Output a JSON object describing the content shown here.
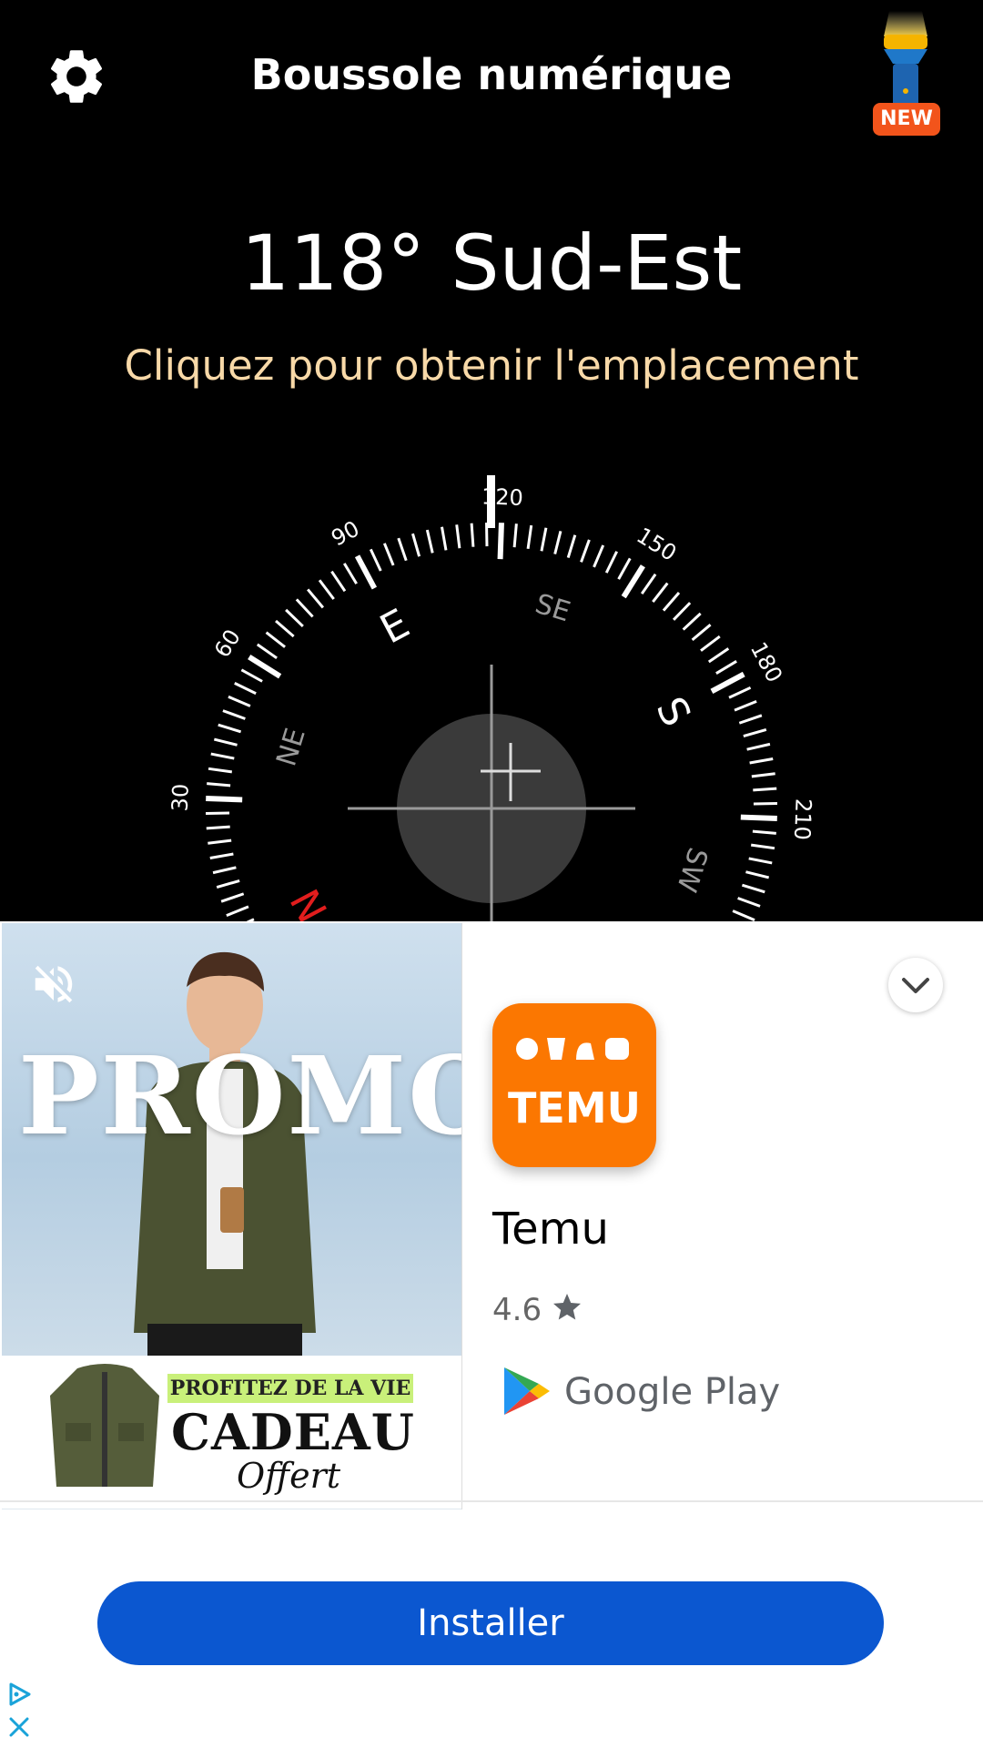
{
  "header": {
    "title": "Boussole numérique",
    "settings_icon": "gear-icon",
    "flashlight_icon": "flashlight-icon",
    "new_badge": "NEW"
  },
  "heading": {
    "degrees": "118°",
    "direction": "Sud-Est"
  },
  "location_prompt": "Cliquez pour obtenir l'emplacement",
  "compass": {
    "heading_value": 118,
    "tick_labels": [
      "30",
      "60",
      "90",
      "120",
      "150",
      "180",
      "210"
    ],
    "cardinals": [
      "N",
      "E",
      "S"
    ],
    "intercardinals": [
      "NE",
      "SE",
      "SW"
    ],
    "north_color": "#e11d1d"
  },
  "ad": {
    "mute_icon": "mute-icon",
    "banner_text": "PROMO",
    "tagline": "PROFITEZ DE LA VIE",
    "offer": "CADEAU",
    "offer_sub": "Offert",
    "collapse_icon": "chevron-down-icon",
    "app_icon_text": "TEMU",
    "app_name": "Temu",
    "rating": "4.6",
    "store": "Google Play",
    "install_label": "Installer",
    "adchoices_icon": "adchoices-icon",
    "close_icon": "close-icon",
    "colors": {
      "brand": "#fb7701",
      "install": "#0b57d0"
    }
  }
}
